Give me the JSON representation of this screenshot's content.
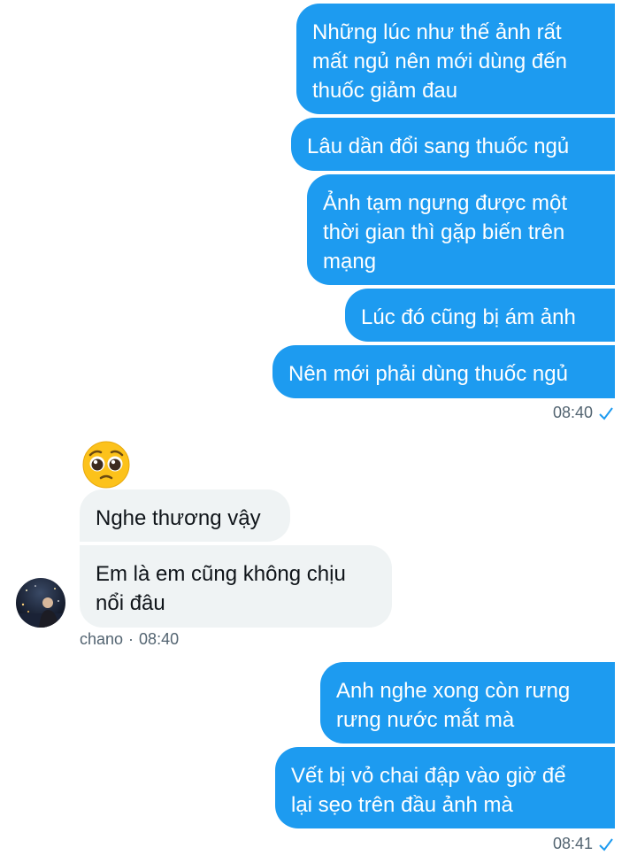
{
  "conversation": {
    "outgoing_group_1": [
      "Những lúc như thế ảnh rất\nmất ngủ nên mới dùng đến\nthuốc giảm đau",
      "Lâu dần đổi sang thuốc ngủ",
      "Ảnh tạm ngưng được một\nthời gian thì gặp biến trên\nmạng",
      "Lúc đó cũng bị ám ảnh",
      "Nên mới phải dùng thuốc ngủ"
    ],
    "outgoing_group_1_time": "08:40",
    "incoming_emoji": "pleading-face",
    "incoming": [
      "Nghe thương vậy",
      "Em là em cũng không chịu\nnổi đâu"
    ],
    "incoming_sender": "chano",
    "incoming_separator": "·",
    "incoming_time": "08:40",
    "outgoing_group_2": [
      "Anh nghe xong còn rưng\nrưng nước mắt mà",
      "Vết bị vỏ chai đập vào giờ để\nlại sẹo trên đầu ảnh mà"
    ],
    "outgoing_group_2_time": "08:41"
  },
  "icons": {
    "read_receipt": "checkmark-icon",
    "avatar": "avatar-image"
  },
  "colors": {
    "accent": "#1d9bf0",
    "incoming_bubble": "#eff3f4",
    "meta_text": "#536471"
  }
}
